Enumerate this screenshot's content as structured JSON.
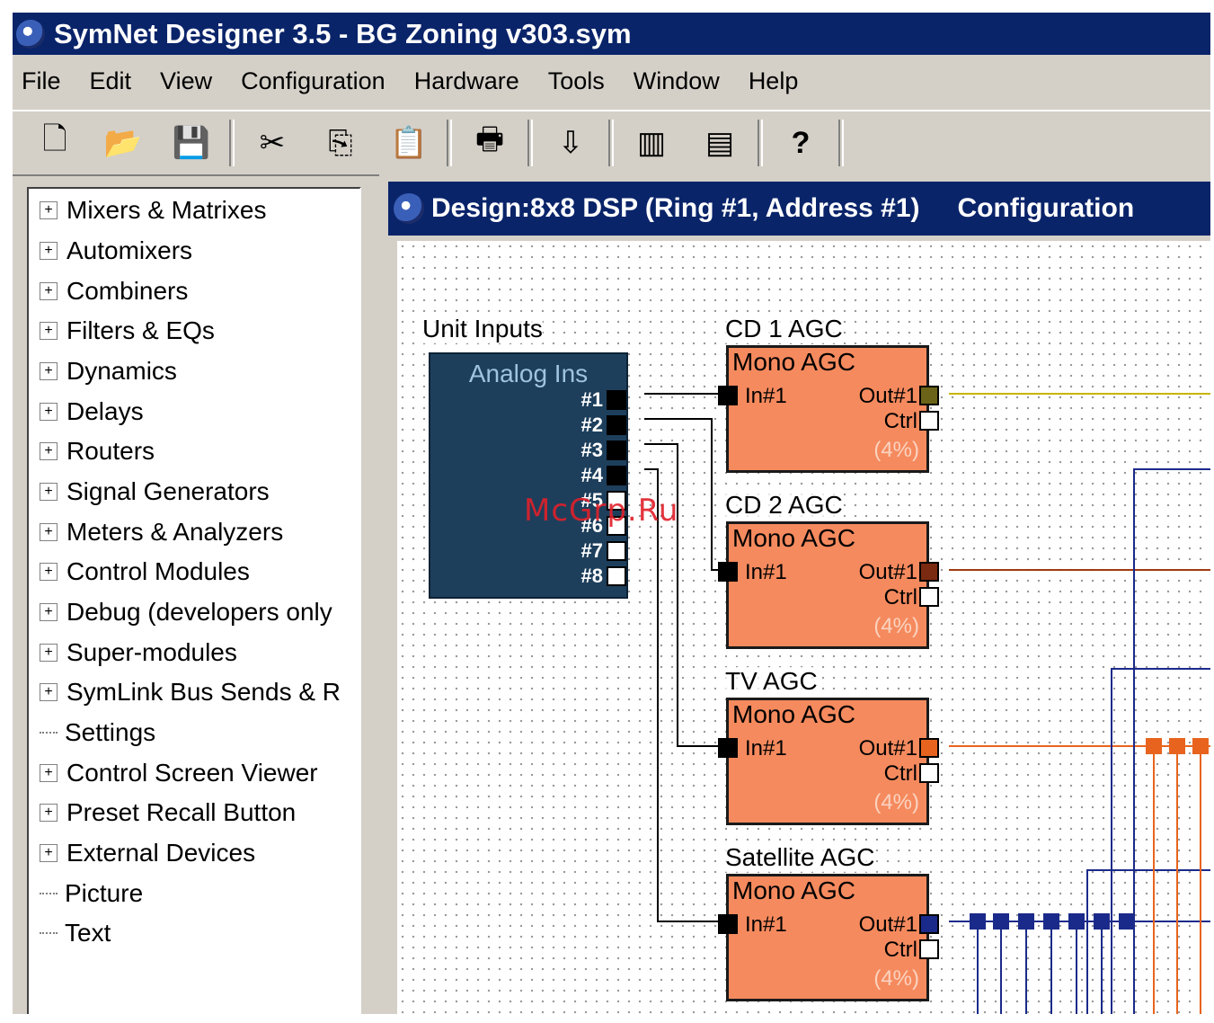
{
  "window": {
    "title": "SymNet Designer 3.5 - BG Zoning v303.sym"
  },
  "menu": [
    "File",
    "Edit",
    "View",
    "Configuration",
    "Hardware",
    "Tools",
    "Window",
    "Help"
  ],
  "toolbar": {
    "buttons": [
      {
        "name": "new-file-icon",
        "glyph": "🗋"
      },
      {
        "name": "open-folder-icon",
        "glyph": "📂"
      },
      {
        "name": "save-icon",
        "glyph": "💾"
      },
      {
        "name": "cut-icon",
        "glyph": "✂"
      },
      {
        "name": "copy-icon",
        "glyph": "⎘"
      },
      {
        "name": "paste-icon",
        "glyph": "📋"
      },
      {
        "name": "print-icon",
        "glyph": "🖶"
      },
      {
        "name": "download-icon",
        "glyph": "⇩"
      },
      {
        "name": "hardware-rack-1-icon",
        "glyph": "▥"
      },
      {
        "name": "hardware-rack-2-icon",
        "glyph": "▤"
      },
      {
        "name": "help-icon",
        "glyph": "?"
      }
    ]
  },
  "tree": [
    {
      "label": "Mixers & Matrixes",
      "expandable": true
    },
    {
      "label": "Automixers",
      "expandable": true
    },
    {
      "label": "Combiners",
      "expandable": true
    },
    {
      "label": "Filters & EQs",
      "expandable": true
    },
    {
      "label": "Dynamics",
      "expandable": true
    },
    {
      "label": "Delays",
      "expandable": true
    },
    {
      "label": "Routers",
      "expandable": true
    },
    {
      "label": "Signal Generators",
      "expandable": true
    },
    {
      "label": "Meters & Analyzers",
      "expandable": true
    },
    {
      "label": "Control Modules",
      "expandable": true
    },
    {
      "label": "Debug (developers only",
      "expandable": true
    },
    {
      "label": "Super-modules",
      "expandable": true
    },
    {
      "label": "SymLink Bus Sends & R",
      "expandable": true
    },
    {
      "label": "Settings",
      "expandable": false
    },
    {
      "label": "Control Screen Viewer",
      "expandable": true
    },
    {
      "label": "Preset Recall Button",
      "expandable": true
    },
    {
      "label": "External Devices",
      "expandable": true
    },
    {
      "label": "Picture",
      "expandable": false
    },
    {
      "label": "Text",
      "expandable": false
    }
  ],
  "design": {
    "title": "Design:8x8 DSP (Ring #1, Address #1)",
    "title_extra": "Configuration",
    "unit_inputs_label": "Unit Inputs",
    "analog_block": {
      "title": "Analog Ins",
      "ports": [
        "#1",
        "#2",
        "#3",
        "#4",
        "#5",
        "#6",
        "#7",
        "#8"
      ]
    },
    "agc_blocks": [
      {
        "label": "CD 1 AGC",
        "name": "Mono AGC",
        "in": "In#1",
        "out": "Out#1",
        "ctrl": "Ctrl",
        "pct": "(4%)",
        "out_color": "#6b6418"
      },
      {
        "label": "CD 2 AGC",
        "name": "Mono AGC",
        "in": "In#1",
        "out": "Out#1",
        "ctrl": "Ctrl",
        "pct": "(4%)",
        "out_color": "#7a2a10"
      },
      {
        "label": "TV AGC",
        "name": "Mono AGC",
        "in": "In#1",
        "out": "Out#1",
        "ctrl": "Ctrl",
        "pct": "(4%)",
        "out_color": "#e8641e"
      },
      {
        "label": "Satellite AGC",
        "name": "Mono AGC",
        "in": "In#1",
        "out": "Out#1",
        "ctrl": "Ctrl",
        "pct": "(4%)",
        "out_color": "#1a2a8a"
      }
    ]
  },
  "watermark": "McGrp.Ru"
}
